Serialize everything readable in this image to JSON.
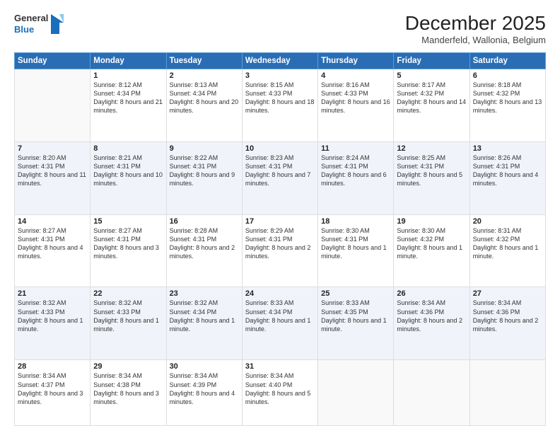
{
  "header": {
    "logo_line1": "General",
    "logo_line2": "Blue",
    "title": "December 2025",
    "subtitle": "Manderfeld, Wallonia, Belgium"
  },
  "days_header": [
    "Sunday",
    "Monday",
    "Tuesday",
    "Wednesday",
    "Thursday",
    "Friday",
    "Saturday"
  ],
  "weeks": [
    [
      {
        "day": "",
        "sunrise": "",
        "sunset": "",
        "daylight": ""
      },
      {
        "day": "1",
        "sunrise": "Sunrise: 8:12 AM",
        "sunset": "Sunset: 4:34 PM",
        "daylight": "Daylight: 8 hours and 21 minutes."
      },
      {
        "day": "2",
        "sunrise": "Sunrise: 8:13 AM",
        "sunset": "Sunset: 4:34 PM",
        "daylight": "Daylight: 8 hours and 20 minutes."
      },
      {
        "day": "3",
        "sunrise": "Sunrise: 8:15 AM",
        "sunset": "Sunset: 4:33 PM",
        "daylight": "Daylight: 8 hours and 18 minutes."
      },
      {
        "day": "4",
        "sunrise": "Sunrise: 8:16 AM",
        "sunset": "Sunset: 4:33 PM",
        "daylight": "Daylight: 8 hours and 16 minutes."
      },
      {
        "day": "5",
        "sunrise": "Sunrise: 8:17 AM",
        "sunset": "Sunset: 4:32 PM",
        "daylight": "Daylight: 8 hours and 14 minutes."
      },
      {
        "day": "6",
        "sunrise": "Sunrise: 8:18 AM",
        "sunset": "Sunset: 4:32 PM",
        "daylight": "Daylight: 8 hours and 13 minutes."
      }
    ],
    [
      {
        "day": "7",
        "sunrise": "Sunrise: 8:20 AM",
        "sunset": "Sunset: 4:31 PM",
        "daylight": "Daylight: 8 hours and 11 minutes."
      },
      {
        "day": "8",
        "sunrise": "Sunrise: 8:21 AM",
        "sunset": "Sunset: 4:31 PM",
        "daylight": "Daylight: 8 hours and 10 minutes."
      },
      {
        "day": "9",
        "sunrise": "Sunrise: 8:22 AM",
        "sunset": "Sunset: 4:31 PM",
        "daylight": "Daylight: 8 hours and 9 minutes."
      },
      {
        "day": "10",
        "sunrise": "Sunrise: 8:23 AM",
        "sunset": "Sunset: 4:31 PM",
        "daylight": "Daylight: 8 hours and 7 minutes."
      },
      {
        "day": "11",
        "sunrise": "Sunrise: 8:24 AM",
        "sunset": "Sunset: 4:31 PM",
        "daylight": "Daylight: 8 hours and 6 minutes."
      },
      {
        "day": "12",
        "sunrise": "Sunrise: 8:25 AM",
        "sunset": "Sunset: 4:31 PM",
        "daylight": "Daylight: 8 hours and 5 minutes."
      },
      {
        "day": "13",
        "sunrise": "Sunrise: 8:26 AM",
        "sunset": "Sunset: 4:31 PM",
        "daylight": "Daylight: 8 hours and 4 minutes."
      }
    ],
    [
      {
        "day": "14",
        "sunrise": "Sunrise: 8:27 AM",
        "sunset": "Sunset: 4:31 PM",
        "daylight": "Daylight: 8 hours and 4 minutes."
      },
      {
        "day": "15",
        "sunrise": "Sunrise: 8:27 AM",
        "sunset": "Sunset: 4:31 PM",
        "daylight": "Daylight: 8 hours and 3 minutes."
      },
      {
        "day": "16",
        "sunrise": "Sunrise: 8:28 AM",
        "sunset": "Sunset: 4:31 PM",
        "daylight": "Daylight: 8 hours and 2 minutes."
      },
      {
        "day": "17",
        "sunrise": "Sunrise: 8:29 AM",
        "sunset": "Sunset: 4:31 PM",
        "daylight": "Daylight: 8 hours and 2 minutes."
      },
      {
        "day": "18",
        "sunrise": "Sunrise: 8:30 AM",
        "sunset": "Sunset: 4:31 PM",
        "daylight": "Daylight: 8 hours and 1 minute."
      },
      {
        "day": "19",
        "sunrise": "Sunrise: 8:30 AM",
        "sunset": "Sunset: 4:32 PM",
        "daylight": "Daylight: 8 hours and 1 minute."
      },
      {
        "day": "20",
        "sunrise": "Sunrise: 8:31 AM",
        "sunset": "Sunset: 4:32 PM",
        "daylight": "Daylight: 8 hours and 1 minute."
      }
    ],
    [
      {
        "day": "21",
        "sunrise": "Sunrise: 8:32 AM",
        "sunset": "Sunset: 4:33 PM",
        "daylight": "Daylight: 8 hours and 1 minute."
      },
      {
        "day": "22",
        "sunrise": "Sunrise: 8:32 AM",
        "sunset": "Sunset: 4:33 PM",
        "daylight": "Daylight: 8 hours and 1 minute."
      },
      {
        "day": "23",
        "sunrise": "Sunrise: 8:32 AM",
        "sunset": "Sunset: 4:34 PM",
        "daylight": "Daylight: 8 hours and 1 minute."
      },
      {
        "day": "24",
        "sunrise": "Sunrise: 8:33 AM",
        "sunset": "Sunset: 4:34 PM",
        "daylight": "Daylight: 8 hours and 1 minute."
      },
      {
        "day": "25",
        "sunrise": "Sunrise: 8:33 AM",
        "sunset": "Sunset: 4:35 PM",
        "daylight": "Daylight: 8 hours and 1 minute."
      },
      {
        "day": "26",
        "sunrise": "Sunrise: 8:34 AM",
        "sunset": "Sunset: 4:36 PM",
        "daylight": "Daylight: 8 hours and 2 minutes."
      },
      {
        "day": "27",
        "sunrise": "Sunrise: 8:34 AM",
        "sunset": "Sunset: 4:36 PM",
        "daylight": "Daylight: 8 hours and 2 minutes."
      }
    ],
    [
      {
        "day": "28",
        "sunrise": "Sunrise: 8:34 AM",
        "sunset": "Sunset: 4:37 PM",
        "daylight": "Daylight: 8 hours and 3 minutes."
      },
      {
        "day": "29",
        "sunrise": "Sunrise: 8:34 AM",
        "sunset": "Sunset: 4:38 PM",
        "daylight": "Daylight: 8 hours and 3 minutes."
      },
      {
        "day": "30",
        "sunrise": "Sunrise: 8:34 AM",
        "sunset": "Sunset: 4:39 PM",
        "daylight": "Daylight: 8 hours and 4 minutes."
      },
      {
        "day": "31",
        "sunrise": "Sunrise: 8:34 AM",
        "sunset": "Sunset: 4:40 PM",
        "daylight": "Daylight: 8 hours and 5 minutes."
      },
      {
        "day": "",
        "sunrise": "",
        "sunset": "",
        "daylight": ""
      },
      {
        "day": "",
        "sunrise": "",
        "sunset": "",
        "daylight": ""
      },
      {
        "day": "",
        "sunrise": "",
        "sunset": "",
        "daylight": ""
      }
    ]
  ]
}
